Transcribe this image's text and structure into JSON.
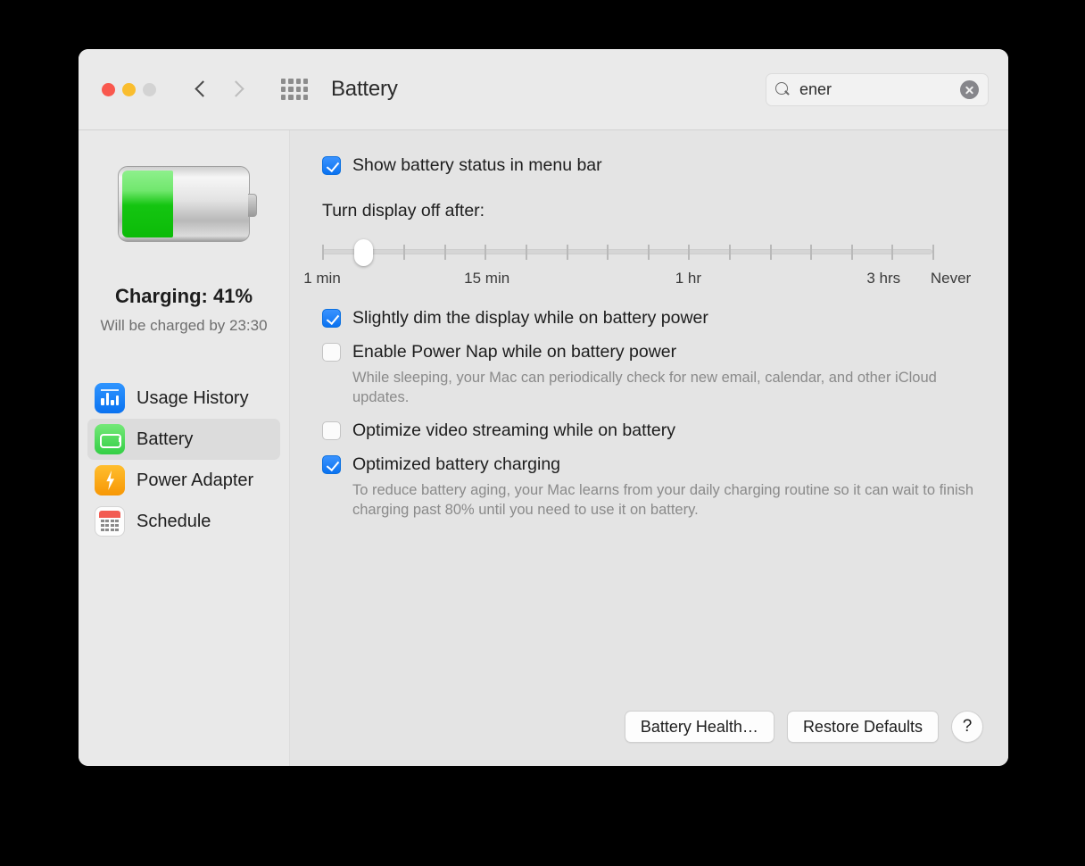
{
  "window": {
    "title": "Battery",
    "traffic_lights": [
      "close-red",
      "minimize-amber",
      "zoom-gray-disabled"
    ],
    "nav": {
      "back": "back-chevron",
      "forward": "forward-chevron-disabled"
    },
    "show_all_icon": "grid-icon"
  },
  "search": {
    "value": "ener",
    "placeholder": "Search",
    "clear_label": "clear-icon"
  },
  "sidebar": {
    "battery_icon_fill_percent": 41,
    "status": "Charging: 41%",
    "substatus": "Will be charged by 23:30",
    "items": [
      {
        "label": "Usage History",
        "icon": "usage-history-icon",
        "selected": false
      },
      {
        "label": "Battery",
        "icon": "battery-icon",
        "selected": true
      },
      {
        "label": "Power Adapter",
        "icon": "power-adapter-icon",
        "selected": false
      },
      {
        "label": "Schedule",
        "icon": "schedule-icon",
        "selected": false
      }
    ]
  },
  "content": {
    "menu_bar_checkbox": {
      "label": "Show battery status in menu bar",
      "checked": true
    },
    "display_off": {
      "label": "Turn display off after:",
      "tick_count": 16,
      "thumb_tick_index": 1,
      "labels": [
        {
          "text": "1 min",
          "pos_percent": 0
        },
        {
          "text": "15 min",
          "pos_percent": 27
        },
        {
          "text": "1 hr",
          "pos_percent": 60
        },
        {
          "text": "3 hrs",
          "pos_percent": 92
        },
        {
          "text": "Never",
          "pos_percent": 103
        }
      ]
    },
    "options": [
      {
        "label": "Slightly dim the display while on battery power",
        "checked": true,
        "description": ""
      },
      {
        "label": "Enable Power Nap while on battery power",
        "checked": false,
        "description": "While sleeping, your Mac can periodically check for new email, calendar, and other iCloud updates."
      },
      {
        "label": "Optimize video streaming while on battery",
        "checked": false,
        "description": ""
      },
      {
        "label": "Optimized battery charging",
        "checked": true,
        "description": "To reduce battery aging, your Mac learns from your daily charging routine so it can wait to finish charging past 80% until you need to use it on battery."
      }
    ],
    "buttons": {
      "battery_health": "Battery Health…",
      "restore_defaults": "Restore Defaults",
      "help": "?"
    }
  },
  "colors": {
    "accent_blue": "#0a72f0",
    "battery_green": "#14c511",
    "window_bg": "#e4e4e4",
    "sidebar_bg": "#e9e9e9",
    "titlebar_bg": "#eaeaea"
  }
}
